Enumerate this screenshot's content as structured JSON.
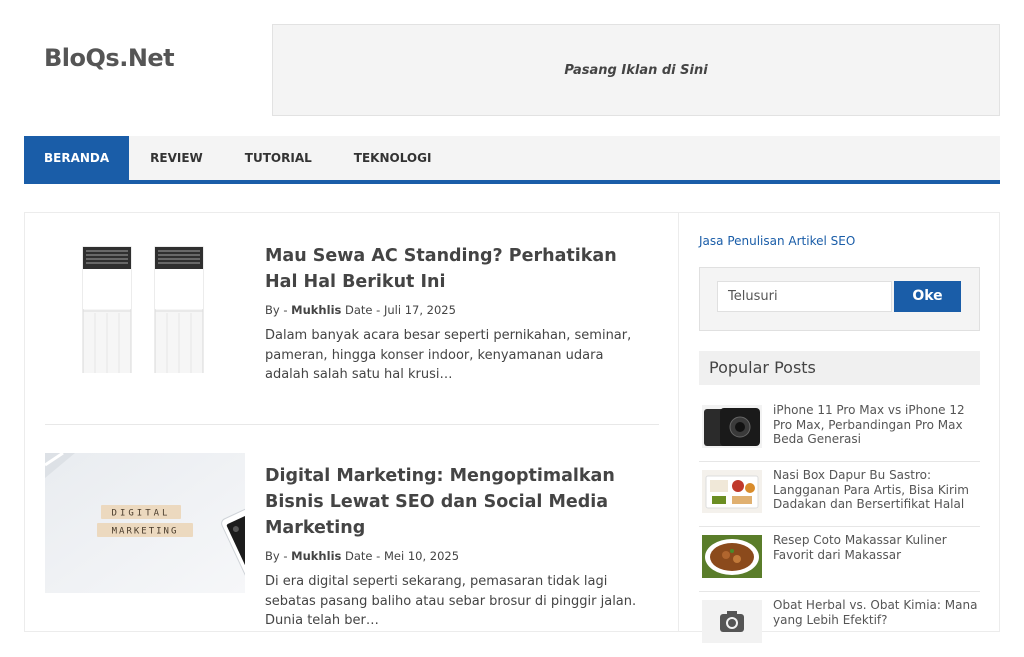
{
  "site": {
    "title": "BloQs.Net"
  },
  "ad": {
    "text": "Pasang Iklan di Sini"
  },
  "nav": {
    "items": [
      {
        "label": "BERANDA",
        "active": true
      },
      {
        "label": "REVIEW",
        "active": false
      },
      {
        "label": "TUTORIAL",
        "active": false
      },
      {
        "label": "TEKNOLOGI",
        "active": false
      }
    ]
  },
  "posts": [
    {
      "title": "Mau Sewa AC Standing? Perhatikan Hal Hal Berikut Ini",
      "by_prefix": "By - ",
      "author": "Mukhlis",
      "date_prefix": " Date - ",
      "date": "Juli 17, 2025",
      "excerpt": "Dalam banyak acara besar seperti pernikahan, seminar, pameran, hingga konser indoor, kenyamanan udara adalah salah satu hal krusi…",
      "thumb_icon": "standing-ac-image"
    },
    {
      "title": "Digital Marketing: Mengoptimalkan Bisnis Lewat SEO dan Social Media Marketing",
      "by_prefix": "By - ",
      "author": "Mukhlis",
      "date_prefix": " Date - ",
      "date": "Mei 10, 2025",
      "excerpt": "Di era digital seperti sekarang, pemasaran tidak lagi sebatas pasang baliho atau sebar brosur di pinggir jalan. Dunia telah ber…",
      "thumb_text_1": "DIGITAL",
      "thumb_text_2": "MARKETING"
    }
  ],
  "sidebar": {
    "seo_link": "Jasa Penulisan Artikel SEO",
    "search": {
      "placeholder": "Telusuri",
      "button": "Oke"
    },
    "popular_title": "Popular Posts",
    "popular": [
      {
        "title": "iPhone 11 Pro Max vs iPhone 12 Pro Max, Perbandingan Pro Max Beda Generasi",
        "icon": "iphone-image"
      },
      {
        "title": "Nasi Box Dapur Bu Sastro: Langganan Para Artis, Bisa Kirim Dadakan dan Bersertifikat Halal",
        "icon": "nasi-box-image"
      },
      {
        "title": "Resep Coto Makassar Kuliner Favorit dari Makassar",
        "icon": "coto-makassar-image"
      },
      {
        "title": "Obat Herbal vs. Obat Kimia: Mana yang Lebih Efektif?",
        "icon": "camera-placeholder-icon"
      }
    ]
  },
  "colors": {
    "accent": "#1a5da8",
    "text": "#444444",
    "panel": "#f4f4f4"
  }
}
